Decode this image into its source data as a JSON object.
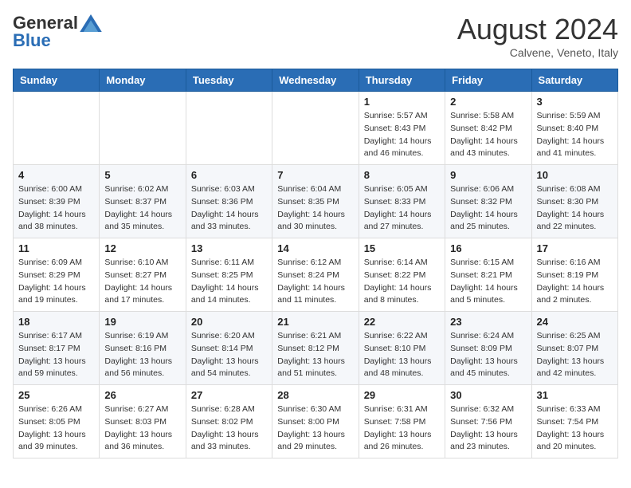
{
  "header": {
    "logo_general": "General",
    "logo_blue": "Blue",
    "month_year": "August 2024",
    "location": "Calvene, Veneto, Italy"
  },
  "weekdays": [
    "Sunday",
    "Monday",
    "Tuesday",
    "Wednesday",
    "Thursday",
    "Friday",
    "Saturday"
  ],
  "weeks": [
    [
      {
        "day": "",
        "info": ""
      },
      {
        "day": "",
        "info": ""
      },
      {
        "day": "",
        "info": ""
      },
      {
        "day": "",
        "info": ""
      },
      {
        "day": "1",
        "info": "Sunrise: 5:57 AM\nSunset: 8:43 PM\nDaylight: 14 hours\nand 46 minutes."
      },
      {
        "day": "2",
        "info": "Sunrise: 5:58 AM\nSunset: 8:42 PM\nDaylight: 14 hours\nand 43 minutes."
      },
      {
        "day": "3",
        "info": "Sunrise: 5:59 AM\nSunset: 8:40 PM\nDaylight: 14 hours\nand 41 minutes."
      }
    ],
    [
      {
        "day": "4",
        "info": "Sunrise: 6:00 AM\nSunset: 8:39 PM\nDaylight: 14 hours\nand 38 minutes."
      },
      {
        "day": "5",
        "info": "Sunrise: 6:02 AM\nSunset: 8:37 PM\nDaylight: 14 hours\nand 35 minutes."
      },
      {
        "day": "6",
        "info": "Sunrise: 6:03 AM\nSunset: 8:36 PM\nDaylight: 14 hours\nand 33 minutes."
      },
      {
        "day": "7",
        "info": "Sunrise: 6:04 AM\nSunset: 8:35 PM\nDaylight: 14 hours\nand 30 minutes."
      },
      {
        "day": "8",
        "info": "Sunrise: 6:05 AM\nSunset: 8:33 PM\nDaylight: 14 hours\nand 27 minutes."
      },
      {
        "day": "9",
        "info": "Sunrise: 6:06 AM\nSunset: 8:32 PM\nDaylight: 14 hours\nand 25 minutes."
      },
      {
        "day": "10",
        "info": "Sunrise: 6:08 AM\nSunset: 8:30 PM\nDaylight: 14 hours\nand 22 minutes."
      }
    ],
    [
      {
        "day": "11",
        "info": "Sunrise: 6:09 AM\nSunset: 8:29 PM\nDaylight: 14 hours\nand 19 minutes."
      },
      {
        "day": "12",
        "info": "Sunrise: 6:10 AM\nSunset: 8:27 PM\nDaylight: 14 hours\nand 17 minutes."
      },
      {
        "day": "13",
        "info": "Sunrise: 6:11 AM\nSunset: 8:25 PM\nDaylight: 14 hours\nand 14 minutes."
      },
      {
        "day": "14",
        "info": "Sunrise: 6:12 AM\nSunset: 8:24 PM\nDaylight: 14 hours\nand 11 minutes."
      },
      {
        "day": "15",
        "info": "Sunrise: 6:14 AM\nSunset: 8:22 PM\nDaylight: 14 hours\nand 8 minutes."
      },
      {
        "day": "16",
        "info": "Sunrise: 6:15 AM\nSunset: 8:21 PM\nDaylight: 14 hours\nand 5 minutes."
      },
      {
        "day": "17",
        "info": "Sunrise: 6:16 AM\nSunset: 8:19 PM\nDaylight: 14 hours\nand 2 minutes."
      }
    ],
    [
      {
        "day": "18",
        "info": "Sunrise: 6:17 AM\nSunset: 8:17 PM\nDaylight: 13 hours\nand 59 minutes."
      },
      {
        "day": "19",
        "info": "Sunrise: 6:19 AM\nSunset: 8:16 PM\nDaylight: 13 hours\nand 56 minutes."
      },
      {
        "day": "20",
        "info": "Sunrise: 6:20 AM\nSunset: 8:14 PM\nDaylight: 13 hours\nand 54 minutes."
      },
      {
        "day": "21",
        "info": "Sunrise: 6:21 AM\nSunset: 8:12 PM\nDaylight: 13 hours\nand 51 minutes."
      },
      {
        "day": "22",
        "info": "Sunrise: 6:22 AM\nSunset: 8:10 PM\nDaylight: 13 hours\nand 48 minutes."
      },
      {
        "day": "23",
        "info": "Sunrise: 6:24 AM\nSunset: 8:09 PM\nDaylight: 13 hours\nand 45 minutes."
      },
      {
        "day": "24",
        "info": "Sunrise: 6:25 AM\nSunset: 8:07 PM\nDaylight: 13 hours\nand 42 minutes."
      }
    ],
    [
      {
        "day": "25",
        "info": "Sunrise: 6:26 AM\nSunset: 8:05 PM\nDaylight: 13 hours\nand 39 minutes."
      },
      {
        "day": "26",
        "info": "Sunrise: 6:27 AM\nSunset: 8:03 PM\nDaylight: 13 hours\nand 36 minutes."
      },
      {
        "day": "27",
        "info": "Sunrise: 6:28 AM\nSunset: 8:02 PM\nDaylight: 13 hours\nand 33 minutes."
      },
      {
        "day": "28",
        "info": "Sunrise: 6:30 AM\nSunset: 8:00 PM\nDaylight: 13 hours\nand 29 minutes."
      },
      {
        "day": "29",
        "info": "Sunrise: 6:31 AM\nSunset: 7:58 PM\nDaylight: 13 hours\nand 26 minutes."
      },
      {
        "day": "30",
        "info": "Sunrise: 6:32 AM\nSunset: 7:56 PM\nDaylight: 13 hours\nand 23 minutes."
      },
      {
        "day": "31",
        "info": "Sunrise: 6:33 AM\nSunset: 7:54 PM\nDaylight: 13 hours\nand 20 minutes."
      }
    ]
  ]
}
